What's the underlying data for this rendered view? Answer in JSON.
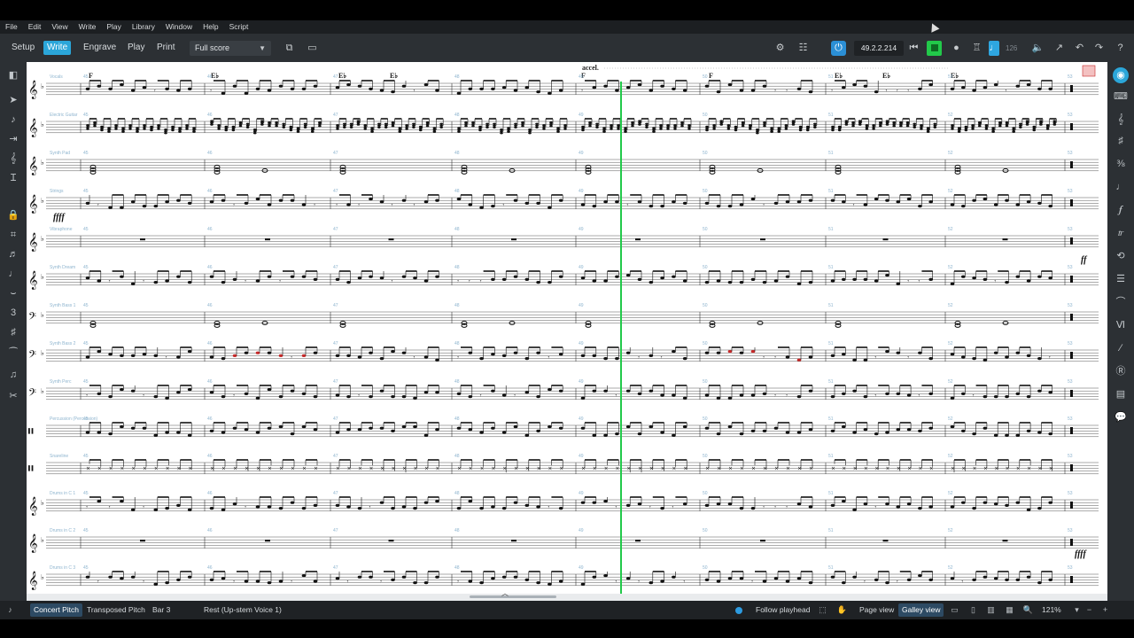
{
  "menu": [
    "File",
    "Edit",
    "View",
    "Write",
    "Play",
    "Library",
    "Window",
    "Help",
    "Script"
  ],
  "toolbar": {
    "modes": [
      "Setup",
      "Write",
      "Engrave",
      "Play",
      "Print"
    ],
    "active_mode": "Write",
    "layout_select": "Full score",
    "timecode": "49.2.2.214",
    "tempo": "126"
  },
  "score": {
    "instruments": [
      {
        "label": "Vocals",
        "clef": "treble"
      },
      {
        "label": "Electric Guitar",
        "clef": "treble"
      },
      {
        "label": "Synth Pad",
        "clef": "treble"
      },
      {
        "label": "Strings",
        "clef": "treble"
      },
      {
        "label": "Vibraphone",
        "clef": "treble"
      },
      {
        "label": "Synth Dream",
        "clef": "treble"
      },
      {
        "label": "Synth Bass 1",
        "clef": "bass"
      },
      {
        "label": "Synth Bass 2",
        "clef": "bass"
      },
      {
        "label": "Synth Perc",
        "clef": "bass"
      },
      {
        "label": "Percussion (Percussion)",
        "clef": "perc"
      },
      {
        "label": "Snareline",
        "clef": "perc"
      },
      {
        "label": "Drums in C 1",
        "clef": "treble"
      },
      {
        "label": "Drums in C 2",
        "clef": "treble"
      },
      {
        "label": "Drums in C 3",
        "clef": "treble"
      }
    ],
    "bar_numbers": [
      "45",
      "46",
      "47",
      "48",
      "49",
      "50",
      "51",
      "52",
      "53"
    ],
    "chord_symbols": [
      "F",
      "E♭",
      "E♭",
      "E♭",
      "F",
      "F",
      "E♭",
      "E♭",
      "E♭",
      "F"
    ],
    "tempo_text": "accel.",
    "dynamics": [
      "ffff",
      "ff",
      "ffff"
    ]
  },
  "status": {
    "concert_pitch": "Concert Pitch",
    "transposed_pitch": "Transposed Pitch",
    "bar": "Bar 3",
    "selection": "Rest (Up-stem Voice 1)",
    "follow_playhead": "Follow playhead",
    "page_view": "Page view",
    "galley_view": "Galley view",
    "zoom": "121%"
  },
  "colors": {
    "accent": "#2ba6d9",
    "playhead": "#22c94a",
    "chrome": "#2c3034"
  }
}
